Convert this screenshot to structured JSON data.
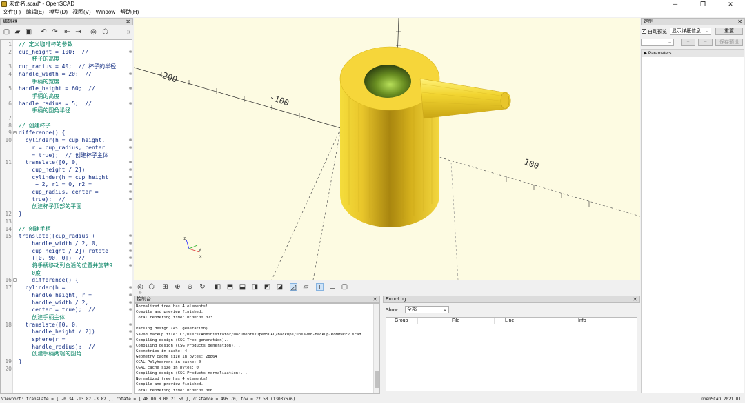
{
  "window": {
    "title": "未命名.scad* - OpenSCAD",
    "minimize": "─",
    "maximize": "❐",
    "close": "✕"
  },
  "menu": [
    "文件(F)",
    "编辑(E)",
    "模型(D)",
    "视图(V)",
    "Window",
    "帮助(H)"
  ],
  "editor": {
    "title": "编辑器",
    "close": "✕",
    "lines": [
      {
        "n": "1",
        "f": "",
        "t": "// 定义咖啡杯的参数",
        "k": "cm",
        "w": ""
      },
      {
        "n": "2",
        "f": "",
        "t": "cup_height = 100;  //",
        "k": "",
        "w": "⇉"
      },
      {
        "n": "",
        "f": "",
        "t": "    杯子的高度",
        "k": "cm",
        "w": ""
      },
      {
        "n": "3",
        "f": "",
        "t": "cup_radius = 40;  // 杯子的半径",
        "k": "",
        "w": ""
      },
      {
        "n": "4",
        "f": "",
        "t": "handle_width = 20;  //",
        "k": "",
        "w": "⇉"
      },
      {
        "n": "",
        "f": "",
        "t": "    手柄的宽度",
        "k": "cm",
        "w": ""
      },
      {
        "n": "5",
        "f": "",
        "t": "handle_height = 60;  //",
        "k": "",
        "w": "⇉"
      },
      {
        "n": "",
        "f": "",
        "t": "    手柄的高度",
        "k": "cm",
        "w": ""
      },
      {
        "n": "6",
        "f": "",
        "t": "handle_radius = 5;  //",
        "k": "",
        "w": "⇉"
      },
      {
        "n": "",
        "f": "",
        "t": "    手柄的圆角半径",
        "k": "cm",
        "w": ""
      },
      {
        "n": "7",
        "f": "",
        "t": "",
        "k": "",
        "w": ""
      },
      {
        "n": "8",
        "f": "",
        "t": "// 创建杯子",
        "k": "cm",
        "w": ""
      },
      {
        "n": "9",
        "f": "⊟",
        "t": "difference() {",
        "k": "",
        "w": ""
      },
      {
        "n": "10",
        "f": "",
        "t": "  cylinder(h = cup_height,",
        "k": "",
        "w": "⇉"
      },
      {
        "n": "",
        "f": "",
        "t": "    r = cup_radius, center",
        "k": "",
        "w": "⇉"
      },
      {
        "n": "",
        "f": "",
        "t": "    = true);  // 创建杯子主体",
        "k": "",
        "w": ""
      },
      {
        "n": "11",
        "f": "",
        "t": "  translate([0, 0,",
        "k": "",
        "w": "⇉"
      },
      {
        "n": "",
        "f": "",
        "t": "    cup_height / 2])",
        "k": "",
        "w": "⇉"
      },
      {
        "n": "",
        "f": "",
        "t": "    cylinder(h = cup_height",
        "k": "",
        "w": "⇉"
      },
      {
        "n": "",
        "f": "",
        "t": "     + 2, r1 = 0, r2 =",
        "k": "",
        "w": "⇉"
      },
      {
        "n": "",
        "f": "",
        "t": "    cup_radius, center =",
        "k": "",
        "w": "⇉"
      },
      {
        "n": "",
        "f": "",
        "t": "    true);  //",
        "k": "",
        "w": "⇉"
      },
      {
        "n": "",
        "f": "",
        "t": "    创建杯子顶部的平面",
        "k": "cm",
        "w": ""
      },
      {
        "n": "12",
        "f": "",
        "t": "}",
        "k": "",
        "w": ""
      },
      {
        "n": "13",
        "f": "",
        "t": "",
        "k": "",
        "w": ""
      },
      {
        "n": "14",
        "f": "",
        "t": "// 创建手柄",
        "k": "cm",
        "w": ""
      },
      {
        "n": "15",
        "f": "",
        "t": "translate([cup_radius +",
        "k": "",
        "w": "⇉"
      },
      {
        "n": "",
        "f": "",
        "t": "    handle_width / 2, 0,",
        "k": "",
        "w": "⇉"
      },
      {
        "n": "",
        "f": "",
        "t": "    cup_height / 2]) rotate",
        "k": "",
        "w": "⇉"
      },
      {
        "n": "",
        "f": "",
        "t": "    ([0, 90, 0])  //",
        "k": "",
        "w": "⇉"
      },
      {
        "n": "",
        "f": "",
        "t": "    将手柄移动到合适的位置并旋转9",
        "k": "cm",
        "w": "⇉"
      },
      {
        "n": "",
        "f": "",
        "t": "    0度",
        "k": "cm",
        "w": ""
      },
      {
        "n": "16",
        "f": "⊟",
        "t": "    difference() {",
        "k": "",
        "w": ""
      },
      {
        "n": "17",
        "f": "",
        "t": "  cylinder(h =",
        "k": "",
        "w": "⇉"
      },
      {
        "n": "",
        "f": "",
        "t": "    handle_height, r =",
        "k": "",
        "w": "⇉"
      },
      {
        "n": "",
        "f": "",
        "t": "    handle_width / 2,",
        "k": "",
        "w": "⇉"
      },
      {
        "n": "",
        "f": "",
        "t": "    center = true);  //",
        "k": "",
        "w": "⇉"
      },
      {
        "n": "",
        "f": "",
        "t": "    创建手柄主体",
        "k": "cm",
        "w": ""
      },
      {
        "n": "18",
        "f": "",
        "t": "  translate([0, 0,",
        "k": "",
        "w": "⇉"
      },
      {
        "n": "",
        "f": "",
        "t": "    handle_height / 2])",
        "k": "",
        "w": "⇉"
      },
      {
        "n": "",
        "f": "",
        "t": "    sphere(r =",
        "k": "",
        "w": "⇉"
      },
      {
        "n": "",
        "f": "",
        "t": "    handle_radius);  //",
        "k": "",
        "w": "⇉"
      },
      {
        "n": "",
        "f": "",
        "t": "    创建手柄两端的圆角",
        "k": "cm",
        "w": ""
      },
      {
        "n": "19",
        "f": "",
        "t": "}",
        "k": "",
        "w": ""
      },
      {
        "n": "20",
        "f": "",
        "t": "",
        "k": "",
        "w": ""
      }
    ]
  },
  "axes": {
    "tick_200": "-200",
    "tick_100": "-100",
    "tick_p100": "100"
  },
  "console": {
    "title": "控制台",
    "close": "✕",
    "lines": [
      "Normalized tree has 4 elements!",
      "Compile and preview finished.",
      "Total rendering time: 0:00:00.073",
      "",
      "Parsing design (AST generation)...",
      "Saved backup file: C:/Users/Administrator/Documents/OpenSCAD/backups/unsaved-backup-RoMM9kFv.scad",
      "Compiling design (CSG Tree generation)...",
      "Compiling design (CSG Products generation)...",
      "Geometries in cache: 4",
      "Geometry cache size in bytes: 28864",
      "CGAL Polyhedrons in cache: 0",
      "CGAL cache size in bytes: 0",
      "Compiling design (CSG Products normalization)...",
      "Normalized tree has 4 elements!",
      "Compile and preview finished.",
      "Total rendering time: 0:00:00.066"
    ]
  },
  "errorlog": {
    "title": "Error-Log",
    "close": "✕",
    "show_label": "Show",
    "show_value": "全部",
    "columns": [
      "Group",
      "File",
      "Line",
      "Info"
    ]
  },
  "customizer": {
    "title": "定制",
    "close": "✕",
    "auto_preview": "自动预览",
    "detail_combo": "显示详细信息",
    "reset": "重置",
    "plus": "+",
    "minus": "−",
    "save_preset": "保存预设",
    "params": "Parameters"
  },
  "status": {
    "left": "Viewport: translate = [ -0.34 -13.82 -3.82 ], rotate = [ 48.00 0.00 21.50 ], distance = 495.70, fov = 22.50 (1303x676)",
    "right": "OpenSCAD 2021.01"
  }
}
